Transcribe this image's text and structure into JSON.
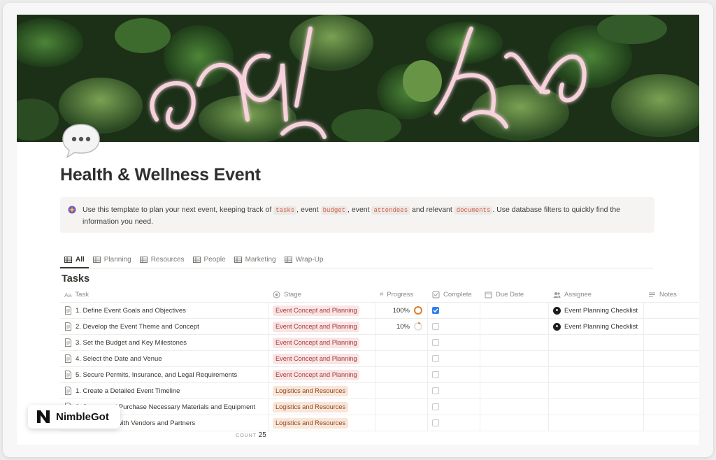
{
  "page": {
    "title": "Health & Wellness Event",
    "icon": "speech-bubble-icon"
  },
  "callout": {
    "icon": "sparkle-icon",
    "text_1": "Use this template to plan your next event, keeping track of ",
    "code_1": "tasks",
    "text_2": ", event ",
    "code_2": "budget",
    "text_3": ", event ",
    "code_3": "attendees",
    "text_4": " and relevant ",
    "code_4": "documents",
    "text_5": ". Use database filters to quickly find the information you need."
  },
  "tabs": [
    {
      "label": "All",
      "active": true
    },
    {
      "label": "Planning"
    },
    {
      "label": "Resources"
    },
    {
      "label": "People"
    },
    {
      "label": "Marketing"
    },
    {
      "label": "Wrap-Up"
    }
  ],
  "database": {
    "title": "Tasks",
    "columns": {
      "task_prefix": "Aa",
      "task": "Task",
      "stage": "Stage",
      "progress_prefix": "#",
      "progress": "Progress",
      "complete": "Complete",
      "due": "Due Date",
      "assignee": "Assignee",
      "notes": "Notes"
    },
    "rows": [
      {
        "task": "1. Define Event Goals and Objectives",
        "stage": "Event Concept and Planning",
        "progress": "100%",
        "complete": true,
        "assignee": "Event Planning Checklist"
      },
      {
        "task": "2. Develop the Event Theme and Concept",
        "stage": "Event Concept and Planning",
        "progress": "10%",
        "complete": false,
        "assignee": "Event Planning Checklist"
      },
      {
        "task": "3. Set the Budget and Key Milestones",
        "stage": "Event Concept and Planning",
        "progress": "",
        "complete": false,
        "assignee": ""
      },
      {
        "task": "4. Select the Date and Venue",
        "stage": "Event Concept and Planning",
        "progress": "",
        "complete": false,
        "assignee": ""
      },
      {
        "task": "5. Secure Permits, Insurance, and Legal Requirements",
        "stage": "Event Concept and Planning",
        "progress": "",
        "complete": false,
        "assignee": ""
      },
      {
        "task": "1. Create a Detailed Event Timeline",
        "stage": "Logistics and Resources",
        "progress": "",
        "complete": false,
        "assignee": ""
      },
      {
        "task": "2. Source and Purchase Necessary Materials and Equipment",
        "stage": "Logistics and Resources",
        "progress": "",
        "complete": false,
        "assignee": ""
      },
      {
        "task": "3. Coordinate with Vendors and Partners",
        "stage": "Logistics and Resources",
        "progress": "",
        "complete": false,
        "assignee": ""
      }
    ],
    "progress_values": [
      1.0,
      0.1
    ],
    "count_label": "COUNT",
    "count_value": "25"
  },
  "brand": {
    "name": "NimbleGot",
    "logo_letter": "N"
  },
  "colors": {
    "checkbox_checked": "#2f80ed",
    "progress_ring": "#d9822b",
    "stage_concept_bg": "#fbe4e4",
    "stage_logistics_bg": "#fae6d9",
    "code_text": "#d15b4a"
  }
}
